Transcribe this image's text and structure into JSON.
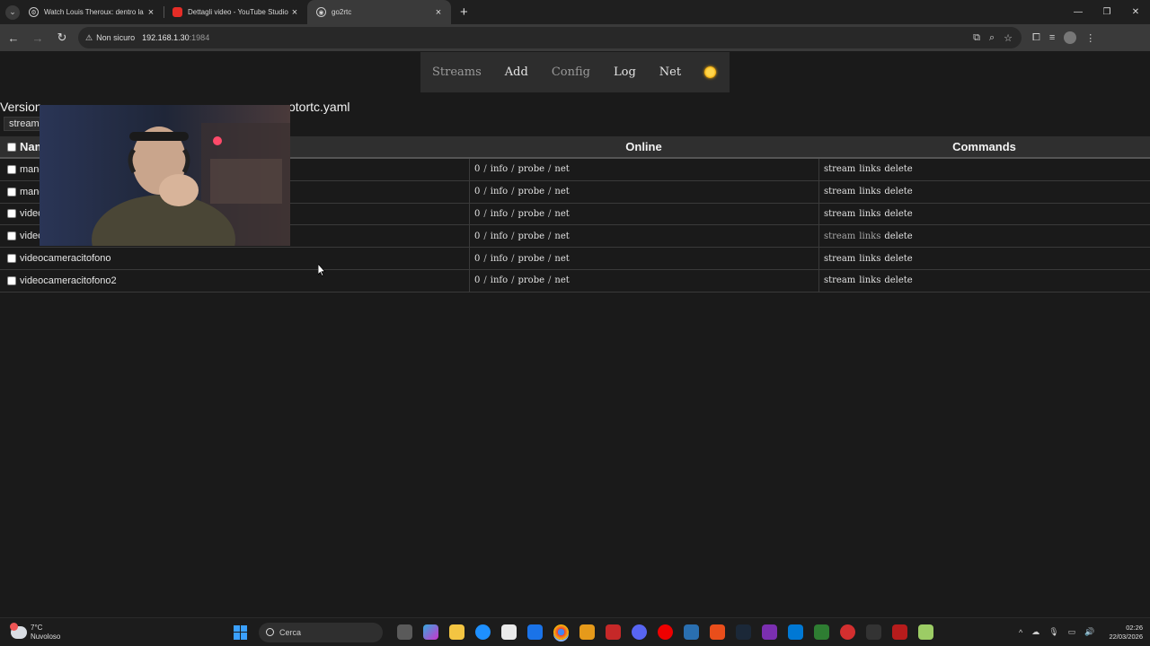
{
  "browser": {
    "tabs": [
      {
        "title": "Watch Louis Theroux: dentro la",
        "icon": "web-icon",
        "active": false
      },
      {
        "title": "Dettagli video - YouTube Studio",
        "icon": "youtube-icon",
        "active": false
      },
      {
        "title": "go2rtc",
        "icon": "go2rtc-icon",
        "active": true
      }
    ],
    "security_label": "Non sicuro",
    "url_host": "192.168.1.30",
    "url_port": ":1984"
  },
  "nav": {
    "items": [
      {
        "label": "Streams",
        "muted": true
      },
      {
        "label": "Add",
        "muted": false
      },
      {
        "label": "Config",
        "muted": true
      },
      {
        "label": "Log",
        "muted": false
      },
      {
        "label": "Net",
        "muted": false
      }
    ],
    "theme_icon": "sun-icon"
  },
  "info": {
    "version_label": "Version",
    "config_suffix": "otortc.yaml",
    "stream_button": "stream"
  },
  "table": {
    "headers": {
      "name": "Nam",
      "online": "Online",
      "commands": "Commands"
    },
    "online_cell": {
      "count": "0",
      "info": "info",
      "probe": "probe",
      "net": "net"
    },
    "commands": {
      "stream": "stream",
      "links": "links",
      "delete": "delete"
    },
    "rows": [
      {
        "name": "manc",
        "visited": false
      },
      {
        "name": "mandarini2",
        "visited": false
      },
      {
        "name": "videocamerabalcone",
        "visited": false
      },
      {
        "name": "videocamerabalcone2",
        "visited": true
      },
      {
        "name": "videocameracitofono",
        "visited": false
      },
      {
        "name": "videocameracitofono2",
        "visited": false
      }
    ]
  },
  "taskbar": {
    "temperature": "7°C",
    "weather": "Nuvoloso",
    "search_placeholder": "Cerca",
    "time": "02:26",
    "date": "22/03/2026"
  },
  "colors": {
    "page_bg": "#1a1a1a",
    "nav_bg": "#2d2d2d",
    "header_bg": "#2f2f2f",
    "accent_sun": "#ffd54a"
  }
}
